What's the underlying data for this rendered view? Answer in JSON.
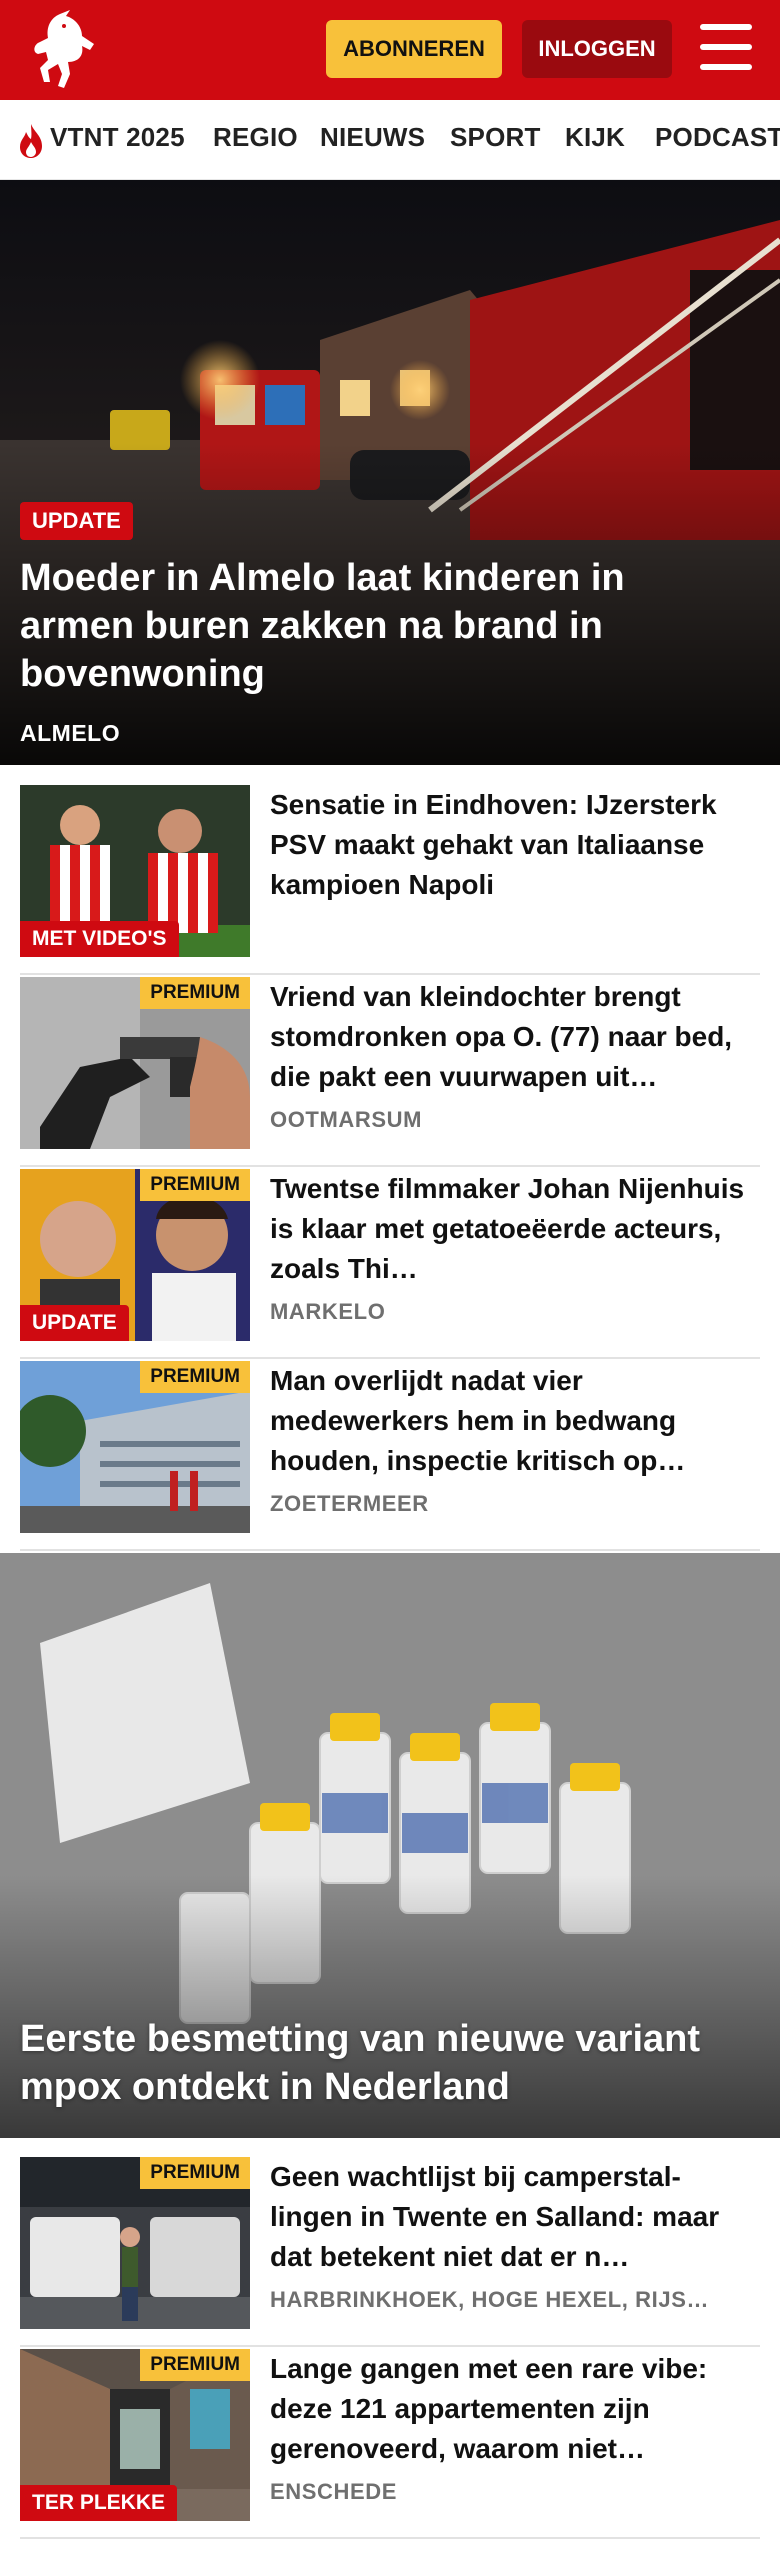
{
  "header": {
    "logo_icon": "twente-horse-logo-icon",
    "subscribe_label": "ABONNEREN",
    "login_label": "INLOGGEN",
    "menu_icon": "hamburger-menu-icon",
    "brand_color": "#cf0a11",
    "accent_color": "#f8c13a"
  },
  "nav": {
    "items": [
      {
        "label": "VTNT 2025",
        "icon": "flame-icon"
      },
      {
        "label": "REGIO"
      },
      {
        "label": "NIEUWS"
      },
      {
        "label": "SPORT"
      },
      {
        "label": "KIJK"
      },
      {
        "label": "PODCAST"
      }
    ]
  },
  "hero": {
    "tag": "UPDATE",
    "title": "Moeder in Almelo laat kinderen in armen buren zakken na brand in bovenwoning",
    "location": "ALMELO"
  },
  "articles": [
    {
      "title": "Sensatie in Eindhoven: IJzersterk PSV maakt gehakt van Italiaanse kampioen Napoli",
      "location": "",
      "premium": "",
      "tag": "MET VIDEO'S"
    },
    {
      "title": "Vriend van kleindochter brengt stomdronken opa O. (77) naar bed, die pakt een vuurwapen uit…",
      "location": "OOTMARSUM",
      "premium": "PREMIUM",
      "tag": ""
    },
    {
      "title": "Twentse filmmaker Johan Nijenhuis is klaar met getatoeëerde acteurs, zoals Thi…",
      "location": "MARKELO",
      "premium": "PREMIUM",
      "tag": "UPDATE"
    },
    {
      "title": "Man overlijdt nadat vier medewerkers hem in bedwang houden, inspectie kritisch op…",
      "location": "ZOETERMEER",
      "premium": "PREMIUM",
      "tag": ""
    }
  ],
  "hero2": {
    "title": "Eerste besmetting van nieuwe variant mpox ontdekt in Nederland"
  },
  "articles2": [
    {
      "title": "Geen wachtlijst bij camperstal- lingen in Twente en Salland: maar dat betekent niet dat er n…",
      "location": "HARBRINKHOEK, HOGE HEXEL, RIJS…",
      "premium": "PREMIUM",
      "tag": ""
    },
    {
      "title": "Lange gangen met een rare vibe: deze 121 appartementen zijn gerenoveerd, waarom niet…",
      "location": "ENSCHEDE",
      "premium": "PREMIUM",
      "tag": "TER PLEKKE"
    }
  ]
}
